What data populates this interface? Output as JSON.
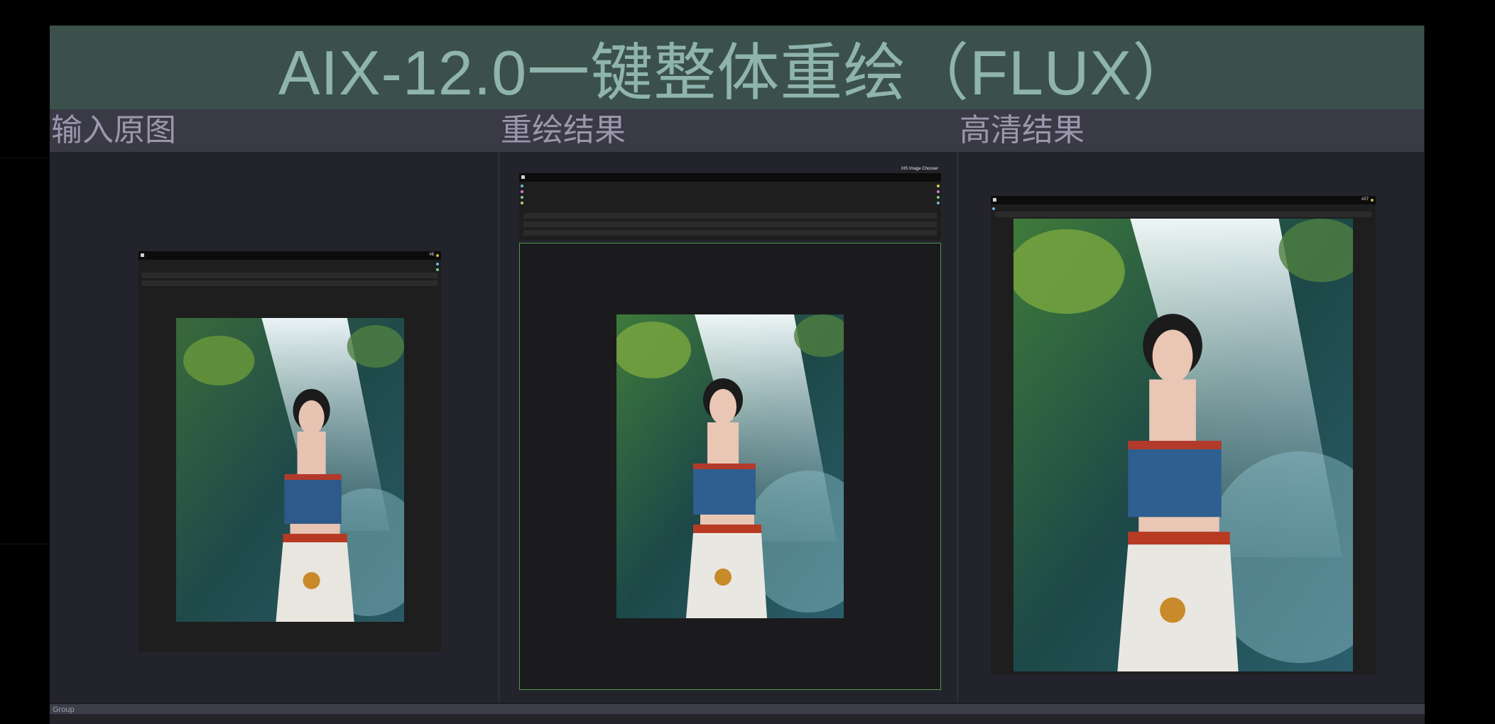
{
  "title": "AIX-12.0一键整体重绘（FLUX）",
  "columns": [
    {
      "label": "输入原图"
    },
    {
      "label": "重绘结果"
    },
    {
      "label": "高清结果"
    }
  ],
  "nodes": {
    "chooser_title": "XIS Image Chooser",
    "input_badge": "#8",
    "hd_badge": "#27"
  },
  "group": {
    "label": "Group"
  },
  "colors": {
    "title_bg": "#3b504b",
    "title_text": "#8fb3ad",
    "header_bg": "#3a3946",
    "header_text": "#9b97ac",
    "preview_border": "#4f9a4a"
  }
}
